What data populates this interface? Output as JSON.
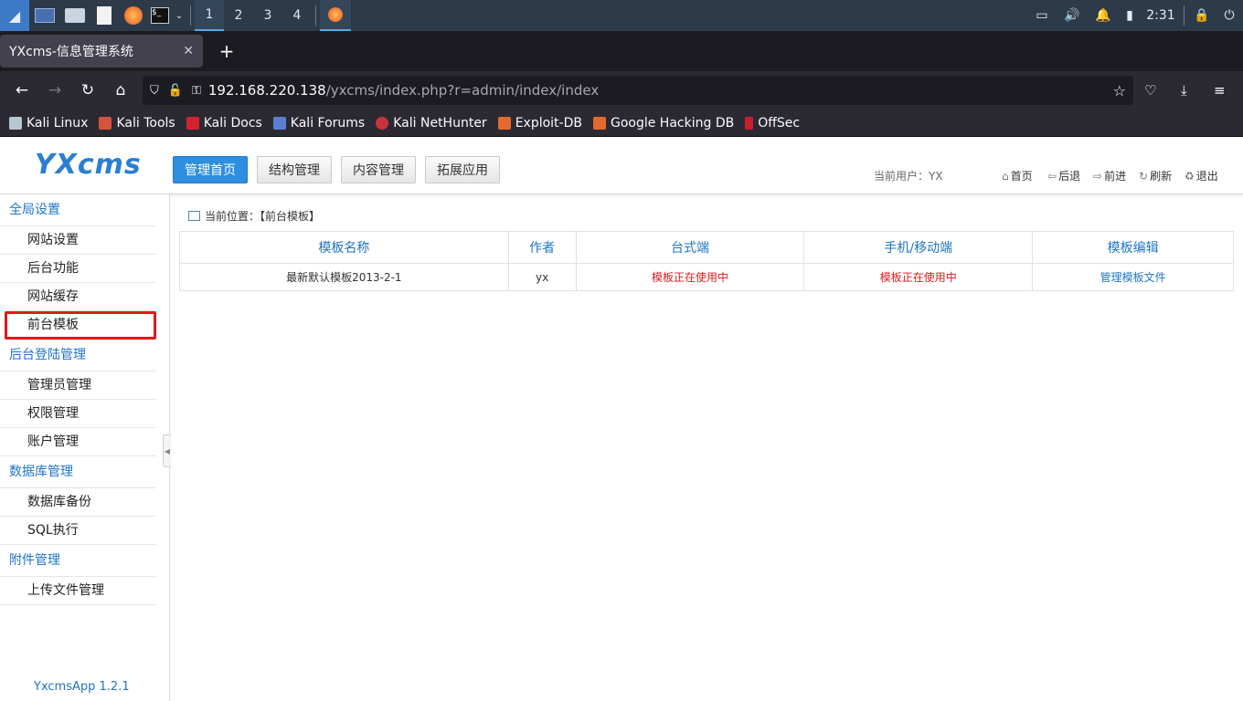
{
  "taskbar": {
    "workspaces": [
      "1",
      "2",
      "3",
      "4"
    ],
    "active_workspace": "1",
    "clock": "2:31"
  },
  "browser": {
    "tab_title": "YXcms-信息管理系统",
    "url_host": "192.168.220.138",
    "url_path": "/yxcms/index.php?r=admin/index/index",
    "bookmarks": [
      "Kali Linux",
      "Kali Tools",
      "Kali Docs",
      "Kali Forums",
      "Kali NetHunter",
      "Exploit-DB",
      "Google Hacking DB",
      "OffSec"
    ]
  },
  "header": {
    "logo": "YXcms",
    "nav": [
      "管理首页",
      "结构管理",
      "内容管理",
      "拓展应用"
    ],
    "current_user": "当前用户：YX",
    "links": [
      "首页",
      "后退",
      "前进",
      "刷新",
      "退出"
    ]
  },
  "sidebar": {
    "groups": [
      {
        "title": "全局设置",
        "items": [
          "网站设置",
          "后台功能",
          "网站缓存",
          "前台模板"
        ]
      },
      {
        "title": "后台登陆管理",
        "items": [
          "管理员管理",
          "权限管理",
          "账户管理"
        ]
      },
      {
        "title": "数据库管理",
        "items": [
          "数据库备份",
          "SQL执行"
        ]
      },
      {
        "title": "附件管理",
        "items": [
          "上传文件管理"
        ]
      }
    ],
    "selected": "前台模板",
    "version": "YxcmsApp 1.2.1"
  },
  "content": {
    "breadcrumb": "当前位置：【前台模板】",
    "table": {
      "headers": [
        "模板名称",
        "作者",
        "台式端",
        "手机/移动端",
        "模板编辑"
      ],
      "rows": [
        [
          "最新默认模板2013-2-1",
          "yx",
          "模板正在使用中",
          "模板正在使用中",
          "管理模板文件"
        ]
      ]
    }
  },
  "colors": {
    "accent": "#2e8fe0",
    "link": "#1f74c6",
    "status_red": "#e01a1a",
    "taskbar": "#2d3a4a"
  }
}
